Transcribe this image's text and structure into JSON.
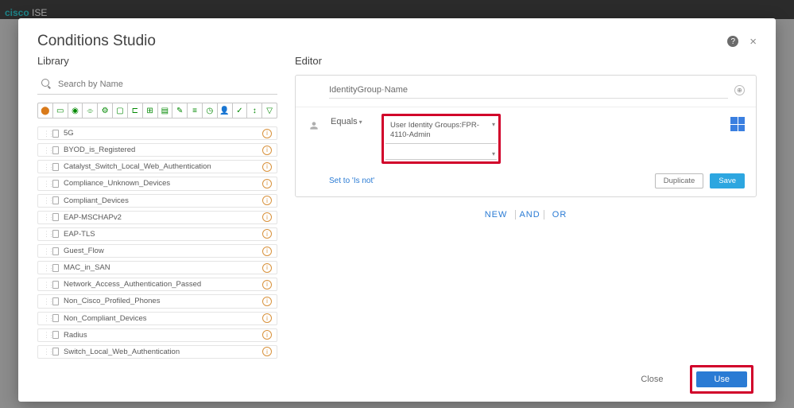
{
  "header": {
    "brand": "cisco",
    "product": "ISE",
    "title": "Conditions Studio"
  },
  "library": {
    "label": "Library",
    "search_placeholder": "Search by Name",
    "items": [
      {
        "name": "5G"
      },
      {
        "name": "BYOD_is_Registered"
      },
      {
        "name": "Catalyst_Switch_Local_Web_Authentication"
      },
      {
        "name": "Compliance_Unknown_Devices"
      },
      {
        "name": "Compliant_Devices"
      },
      {
        "name": "EAP-MSCHAPv2"
      },
      {
        "name": "EAP-TLS"
      },
      {
        "name": "Guest_Flow"
      },
      {
        "name": "MAC_in_SAN"
      },
      {
        "name": "Network_Access_Authentication_Passed"
      },
      {
        "name": "Non_Cisco_Profiled_Phones"
      },
      {
        "name": "Non_Compliant_Devices"
      },
      {
        "name": "Radius"
      },
      {
        "name": "Switch_Local_Web_Authentication"
      }
    ]
  },
  "editor": {
    "label": "Editor",
    "attribute": "IdentityGroup·Name",
    "operator": "Equals",
    "value": "User Identity Groups:FPR-4110-Admin",
    "set_not": "Set to 'Is not'",
    "duplicate": "Duplicate",
    "save": "Save",
    "logic": {
      "new": "NEW",
      "and": "AND",
      "or": "OR"
    }
  },
  "footer": {
    "close": "Close",
    "use": "Use"
  }
}
